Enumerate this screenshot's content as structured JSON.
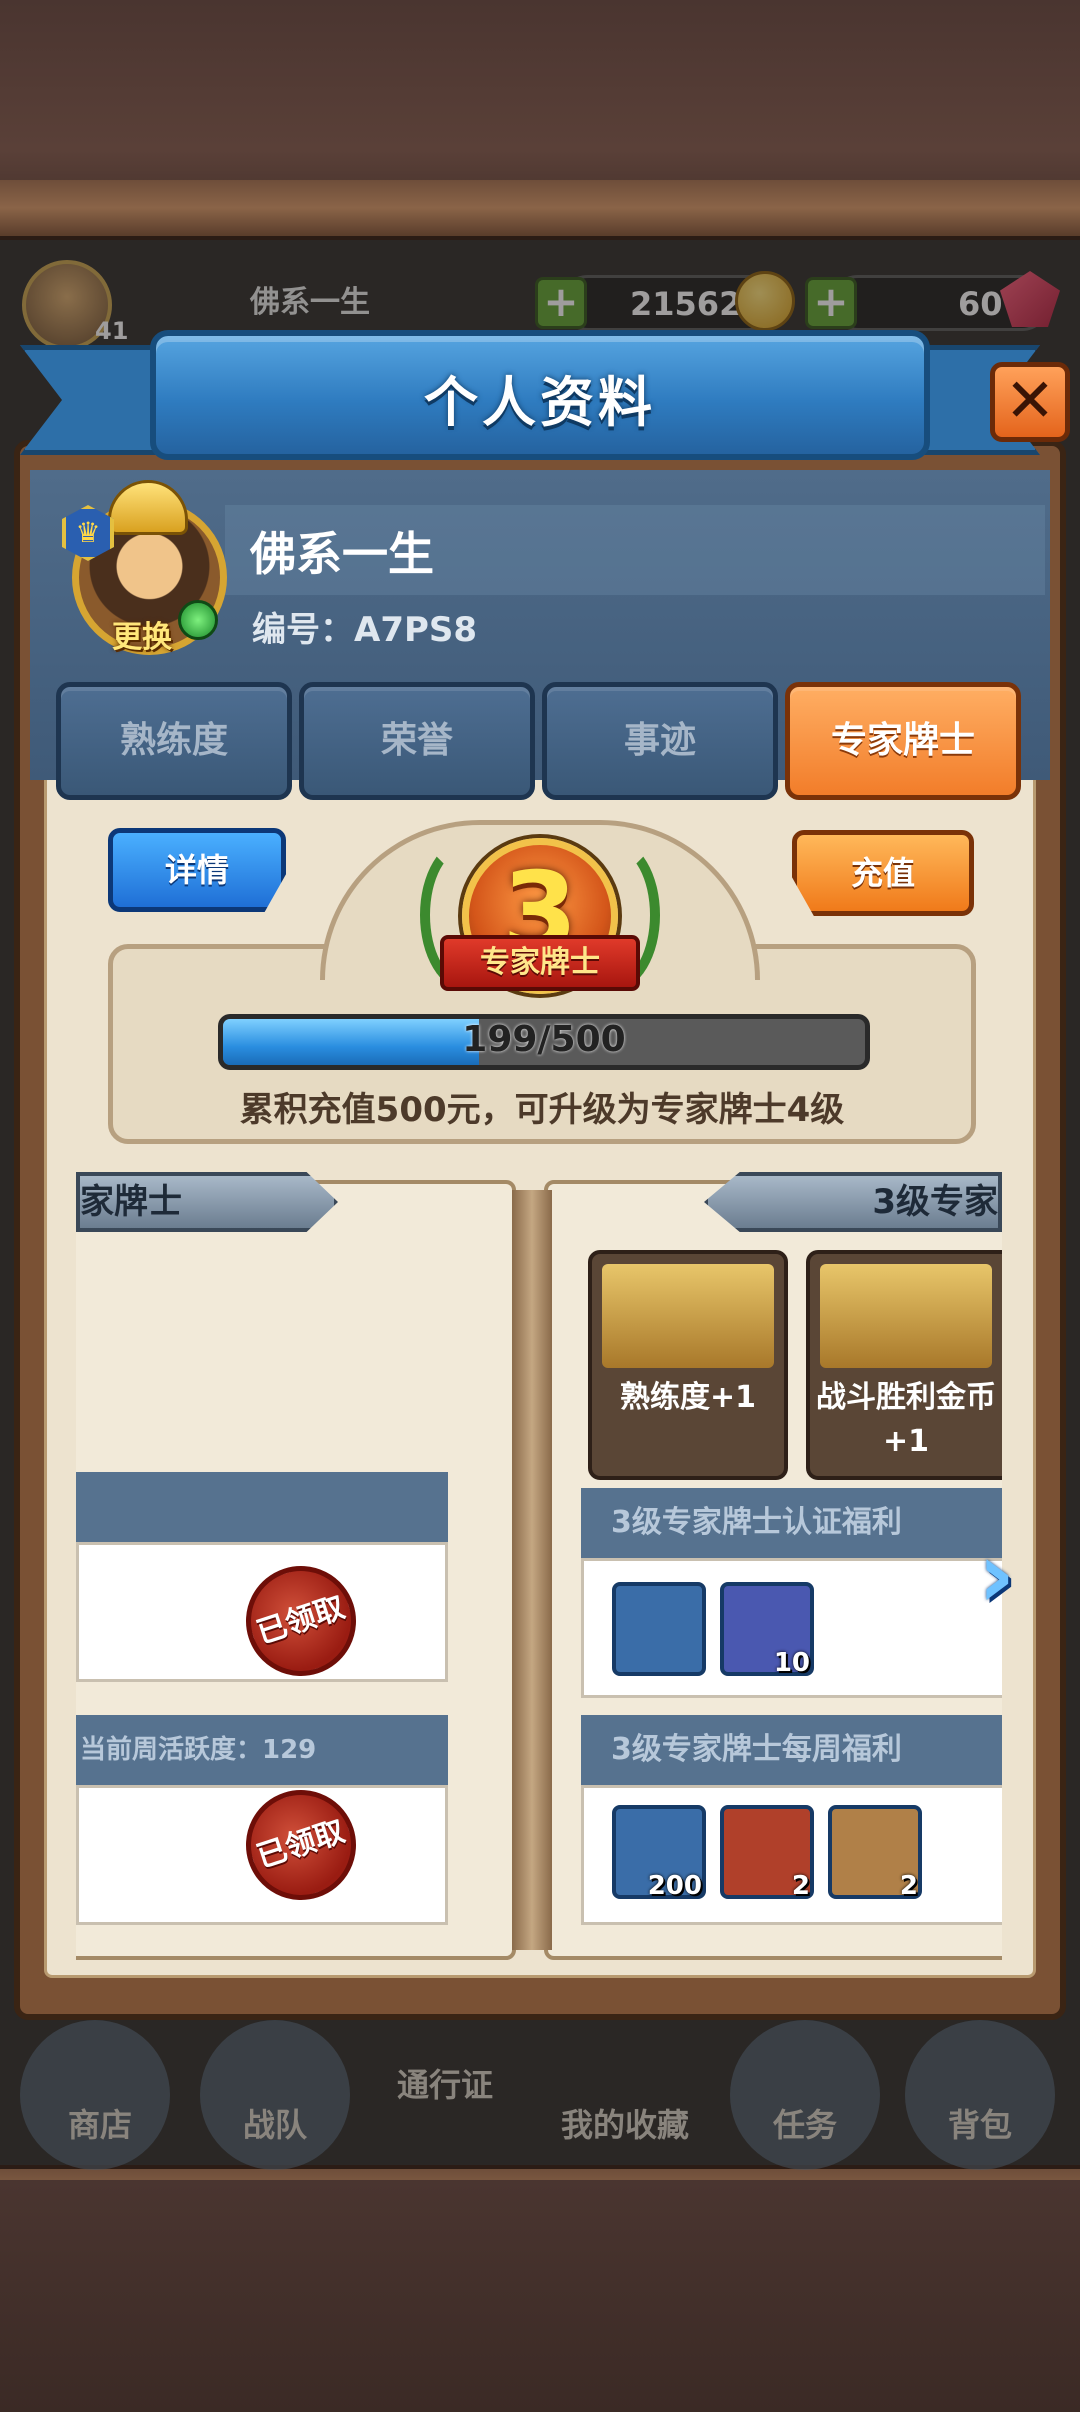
{
  "hud": {
    "player_name": "佛系一生",
    "player_level": "41",
    "gold": "21562",
    "gems": "60"
  },
  "dialog": {
    "title": "个人资料",
    "close_label": "✕"
  },
  "profile": {
    "name": "佛系一生",
    "id_label": "编号：A7PS8",
    "change_avatar_label": "更换"
  },
  "tabs": [
    {
      "label": "熟练度",
      "active": false
    },
    {
      "label": "荣誉",
      "active": false
    },
    {
      "label": "事迹",
      "active": false
    },
    {
      "label": "专家牌士",
      "active": true
    }
  ],
  "expert": {
    "detail_button": "详情",
    "recharge_button": "充值",
    "badge_level": "3",
    "badge_title": "专家牌士",
    "progress_current": 199,
    "progress_max": 500,
    "progress_text": "199/500",
    "hint": "累积充值500元，可升级为专家牌士4级"
  },
  "book": {
    "left_banner": "家牌士",
    "right_banner": "3级专家",
    "left_sections": {
      "weekly_activity": "当前周活跃度：129",
      "claimed_label_1": "已领取",
      "claimed_label_2": "已领取"
    },
    "perks": [
      {
        "label": "熟练度+1",
        "icon": "level-up-arrow-icon"
      },
      {
        "label": "战斗胜利金币+1",
        "icon": "gold-coin-hand-icon"
      }
    ],
    "cert_section": {
      "title": "3级专家牌士认证福利",
      "items": [
        {
          "icon": "blue-dragon-avatar-icon",
          "count": ""
        },
        {
          "icon": "card-pack-icon",
          "count": "10"
        }
      ]
    },
    "weekly_section": {
      "title": "3级专家牌士每周福利",
      "items": [
        {
          "icon": "gold-coin-icon",
          "count": "200"
        },
        {
          "icon": "treasure-chest-icon",
          "count": "2"
        },
        {
          "icon": "card-bag-icon",
          "count": "2"
        }
      ]
    }
  },
  "bottom_nav": [
    "商店",
    "战队",
    "通行证",
    "我的收藏",
    "任务",
    "背包"
  ],
  "colors": {
    "accent_blue": "#2f7cc0",
    "active_tab": "#f27d2a",
    "tab_bg": "#3a5877",
    "progress_fill": "#2a8ee0"
  }
}
